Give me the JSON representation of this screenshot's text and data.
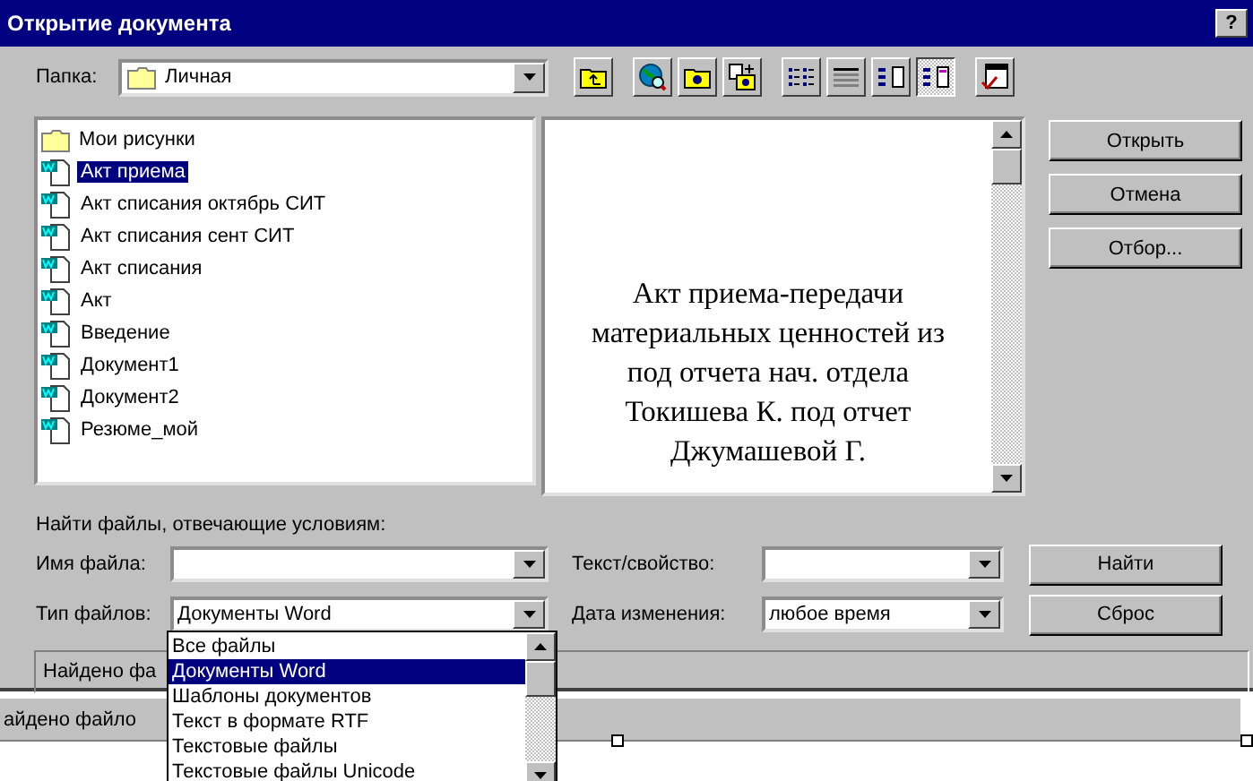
{
  "window": {
    "title": "Открытие документа",
    "help_button": "?"
  },
  "folder": {
    "label": "Папка:",
    "value": "Личная"
  },
  "toolbar": [
    {
      "kind": "up",
      "selected": false
    },
    {
      "kind": "web",
      "selected": false
    },
    {
      "kind": "favorites",
      "selected": false
    },
    {
      "kind": "add-favorite",
      "selected": false
    },
    {
      "kind": "list",
      "selected": false
    },
    {
      "kind": "details",
      "selected": false
    },
    {
      "kind": "properties",
      "selected": false
    },
    {
      "kind": "preview",
      "selected": true
    },
    {
      "kind": "commands",
      "selected": false
    }
  ],
  "files": [
    {
      "name": "Мои рисунки",
      "kind": "folder",
      "selected": false
    },
    {
      "name": "Акт приема",
      "kind": "document",
      "selected": true
    },
    {
      "name": "Акт списания октябрь СИТ",
      "kind": "document",
      "selected": false
    },
    {
      "name": "Акт списания сент СИТ",
      "kind": "document",
      "selected": false
    },
    {
      "name": "Акт списания",
      "kind": "document",
      "selected": false
    },
    {
      "name": "Акт",
      "kind": "document",
      "selected": false
    },
    {
      "name": "Введение",
      "kind": "document",
      "selected": false
    },
    {
      "name": "Документ1",
      "kind": "document",
      "selected": false
    },
    {
      "name": "Документ2",
      "kind": "document",
      "selected": false
    },
    {
      "name": "Резюме_мой",
      "kind": "document",
      "selected": false
    }
  ],
  "preview": {
    "lines": [
      "Акт приема-передачи",
      "материальных ценностей из",
      "под отчета нач. отдела",
      "Токишева К.  под отчет",
      "Джумашевой Г."
    ]
  },
  "buttons": [
    "Открыть",
    "Отмена",
    "Отбор..."
  ],
  "search": {
    "heading": "Найти файлы, отвечающие условиям:",
    "file_name": {
      "label": "Имя файла:"
    },
    "text_property": {
      "label": "Текст/свойство:"
    },
    "file_type": {
      "label": "Тип файлов:",
      "value": "Документы Word"
    },
    "date": {
      "label": "Дата изменения:",
      "value": "любое время"
    },
    "buttons": [
      "Найти",
      "Сброс"
    ]
  },
  "found": "Найдено фа",
  "file_type_list": [
    {
      "label": "Все файлы",
      "selected": false
    },
    {
      "label": "Документы Word",
      "selected": true
    },
    {
      "label": "Шаблоны документов",
      "selected": false
    },
    {
      "label": "Текст в формате RTF",
      "selected": false
    },
    {
      "label": "Текстовые файлы",
      "selected": false
    },
    {
      "label": "Текстовые файлы Unicode",
      "selected": false
    }
  ],
  "status": "айдено файло"
}
